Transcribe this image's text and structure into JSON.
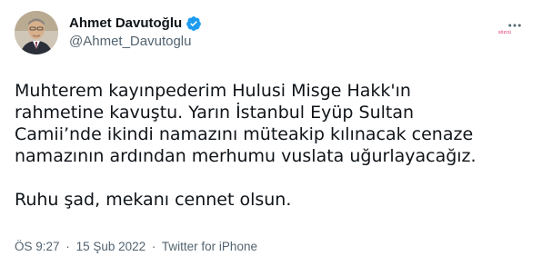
{
  "user": {
    "display_name": "Ahmet Davutoğlu",
    "handle": "@Ahmet_Davutoglu",
    "verified_icon": "verified-badge-icon",
    "avatar_icon": "profile-photo"
  },
  "watermark": "sözcü",
  "tweet": {
    "lines": [
      "Muhterem kayınpederim Hulusi Misge Hakk'ın",
      "rahmetine kavuştu. Yarın İstanbul Eyüp Sultan",
      "Camii’nde ikindi namazını müteakip kılınacak cenaze",
      "namazının ardından merhumu vuslata uğurlayacağız."
    ],
    "closing": "Ruhu şad, mekanı cennet olsun."
  },
  "meta": {
    "time": "ÖS 9:27",
    "separator": "·",
    "date": "15 Şub 2022",
    "source": "Twitter for iPhone"
  },
  "colors": {
    "text": "#0f1419",
    "secondary": "#536471",
    "verified": "#1d9bf0"
  }
}
